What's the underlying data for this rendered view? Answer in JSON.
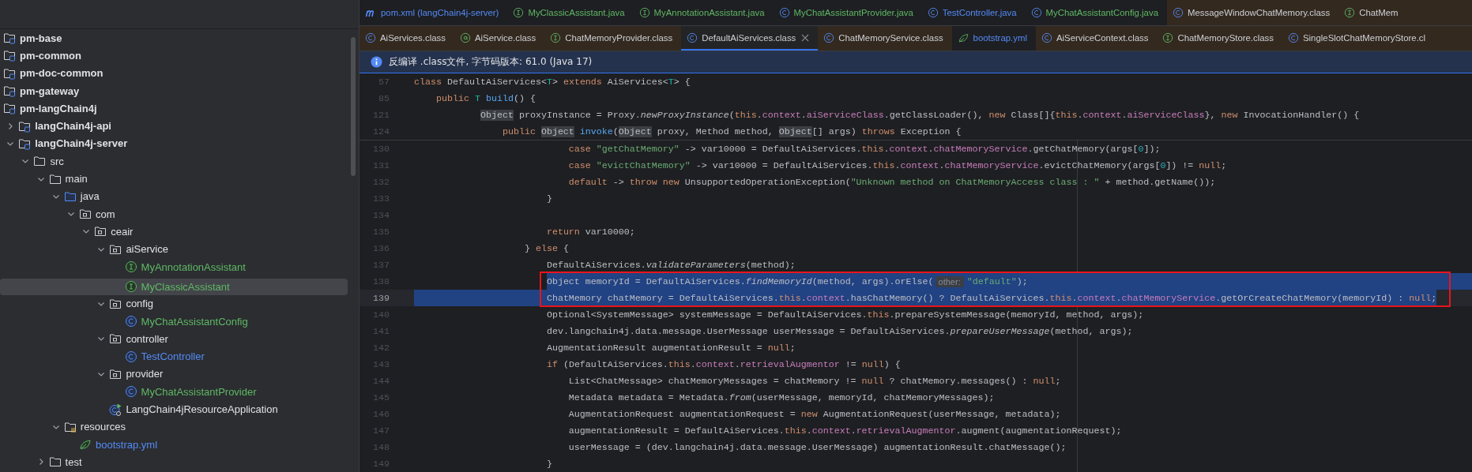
{
  "sidebar": {
    "items": [
      {
        "label": "pm-base",
        "kind": "module",
        "selected": false
      },
      {
        "label": "pm-common",
        "kind": "module",
        "selected": false
      },
      {
        "label": "pm-doc-common",
        "kind": "module",
        "selected": false
      },
      {
        "label": "pm-gateway",
        "kind": "module",
        "selected": false
      },
      {
        "label": "pm-langChain4j",
        "kind": "module",
        "selected": false,
        "children": [
          {
            "label": "langChain4j-api",
            "kind": "module",
            "expanded": false,
            "selected": false
          },
          {
            "label": "langChain4j-server",
            "kind": "module",
            "expanded": true,
            "selected": false,
            "children": [
              {
                "label": "src",
                "kind": "folder",
                "expanded": true,
                "selected": false,
                "children": [
                  {
                    "label": "main",
                    "kind": "folder",
                    "expanded": true,
                    "selected": false,
                    "children": [
                      {
                        "label": "java",
                        "kind": "source_root",
                        "expanded": true,
                        "selected": false,
                        "children": [
                          {
                            "label": "com",
                            "kind": "package",
                            "expanded": true,
                            "selected": false,
                            "children": [
                              {
                                "label": "ceair",
                                "kind": "package",
                                "expanded": true,
                                "selected": false,
                                "children": [
                                  {
                                    "label": "aiService",
                                    "kind": "package",
                                    "expanded": true,
                                    "selected": false,
                                    "children": [
                                      {
                                        "label": "MyAnnotationAssistant",
                                        "kind": "interface",
                                        "color": "#5fb865",
                                        "selected": false
                                      },
                                      {
                                        "label": "MyClassicAssistant",
                                        "kind": "interface",
                                        "color": "#5fb865",
                                        "selected": true
                                      }
                                    ]
                                  },
                                  {
                                    "label": "config",
                                    "kind": "package",
                                    "expanded": true,
                                    "selected": false,
                                    "children": [
                                      {
                                        "label": "MyChatAssistantConfig",
                                        "kind": "class",
                                        "color": "#5fb865",
                                        "selected": false
                                      }
                                    ]
                                  },
                                  {
                                    "label": "controller",
                                    "kind": "package",
                                    "expanded": true,
                                    "selected": false,
                                    "children": [
                                      {
                                        "label": "TestController",
                                        "kind": "class",
                                        "color": "#548af7",
                                        "selected": false
                                      }
                                    ]
                                  },
                                  {
                                    "label": "provider",
                                    "kind": "package",
                                    "expanded": true,
                                    "selected": false,
                                    "children": [
                                      {
                                        "label": "MyChatAssistantProvider",
                                        "kind": "class",
                                        "color": "#5fb865",
                                        "selected": false
                                      }
                                    ]
                                  },
                                  {
                                    "label": "LangChain4jResourceApplication",
                                    "kind": "app",
                                    "selected": false
                                  }
                                ]
                              }
                            ]
                          }
                        ]
                      },
                      {
                        "label": "resources",
                        "kind": "resources",
                        "expanded": true,
                        "selected": false,
                        "children": [
                          {
                            "label": "bootstrap.yml",
                            "kind": "yaml",
                            "color": "#548af7",
                            "selected": false
                          }
                        ]
                      }
                    ]
                  },
                  {
                    "label": "test",
                    "kind": "folder",
                    "expanded": false,
                    "selected": false
                  }
                ]
              }
            ]
          }
        ]
      }
    ]
  },
  "tabs_row_1": [
    {
      "label": "pom.xml (langChain4j-server)",
      "kind": "maven",
      "color": "#548af7",
      "library": false,
      "selected": false
    },
    {
      "label": "MyClassicAssistant.java",
      "kind": "interface",
      "color": "#5fb865",
      "library": false,
      "selected": false
    },
    {
      "label": "MyAnnotationAssistant.java",
      "kind": "interface",
      "color": "#5fb865",
      "library": false,
      "selected": false
    },
    {
      "label": "MyChatAssistantProvider.java",
      "kind": "class",
      "color": "#5fb865",
      "library": false,
      "selected": false
    },
    {
      "label": "TestController.java",
      "kind": "class",
      "color": "#548af7",
      "library": false,
      "selected": false
    },
    {
      "label": "MyChatAssistantConfig.java",
      "kind": "class",
      "color": "#5fb865",
      "library": false,
      "selected": false
    },
    {
      "label": "MessageWindowChatMemory.class",
      "kind": "class",
      "library": true,
      "selected": false
    },
    {
      "label": "ChatMem",
      "kind": "interface",
      "library": true,
      "selected": false
    }
  ],
  "tabs_row_2": [
    {
      "label": "AiServices.class",
      "kind": "class",
      "library": true,
      "selected": false
    },
    {
      "label": "AiService.class",
      "kind": "annotation",
      "library": true,
      "selected": false
    },
    {
      "label": "ChatMemoryProvider.class",
      "kind": "interface",
      "library": true,
      "selected": false
    },
    {
      "label": "DefaultAiServices.class",
      "kind": "class",
      "library": true,
      "selected": true
    },
    {
      "label": "ChatMemoryService.class",
      "kind": "class",
      "library": true,
      "selected": false
    },
    {
      "label": "bootstrap.yml",
      "kind": "yaml",
      "color": "#548af7",
      "library": false,
      "selected": false
    },
    {
      "label": "AiServiceContext.class",
      "kind": "class",
      "library": true,
      "selected": false
    },
    {
      "label": "ChatMemoryStore.class",
      "kind": "interface",
      "library": true,
      "selected": false
    },
    {
      "label": "SingleSlotChatMemoryStore.cl",
      "kind": "class",
      "library": true,
      "selected": false
    }
  ],
  "info_bar": {
    "text": "反编译 .class文件, 字节码版本: 61.0 (Java 17)"
  },
  "editor": {
    "sticky_lines": [
      {
        "number": "57",
        "tokens": [
          {
            "kind": "keyword",
            "text": "class"
          },
          {
            "text": " DefaultAiServices<"
          },
          {
            "kind": "type_parameter",
            "text": "T"
          },
          {
            "text": "> "
          },
          {
            "kind": "keyword",
            "text": "extends"
          },
          {
            "text": " AiServices<"
          },
          {
            "kind": "type_parameter",
            "text": "T"
          },
          {
            "text": "> {"
          }
        ]
      },
      {
        "number": "85",
        "tokens": [
          {
            "kind": "keyword",
            "text": "    public"
          },
          {
            "text": " T",
            "kind": "type_parameter"
          },
          {
            "kind": "declaration",
            "text": " build"
          },
          {
            "text": "() {"
          }
        ]
      },
      {
        "number": "121",
        "tokens": [
          {
            "kind": "usage",
            "text": "            Object"
          },
          {
            "text": " proxyInstance = Proxy."
          },
          {
            "kind": "static_call",
            "text": "newProxyInstance"
          },
          {
            "text": "("
          },
          {
            "kind": "keyword",
            "text": "this"
          },
          {
            "text": "."
          },
          {
            "kind": "field",
            "text": "context"
          },
          {
            "text": "."
          },
          {
            "kind": "field",
            "text": "aiServiceClass"
          },
          {
            "text": ".getClassLoader(), "
          },
          {
            "kind": "keyword",
            "text": "new"
          },
          {
            "text": " Class[]{"
          },
          {
            "kind": "keyword",
            "text": "this"
          },
          {
            "text": "."
          },
          {
            "kind": "field",
            "text": "context"
          },
          {
            "text": "."
          },
          {
            "kind": "field",
            "text": "aiServiceClass"
          },
          {
            "text": "}, "
          },
          {
            "kind": "keyword",
            "text": "new"
          },
          {
            "text": " InvocationHandler() {"
          }
        ]
      },
      {
        "number": "124",
        "tokens": [
          {
            "kind": "keyword",
            "text": "                public "
          },
          {
            "kind": "usage",
            "text": "Object"
          },
          {
            "kind": "declaration",
            "text": " invoke"
          },
          {
            "text": "("
          },
          {
            "kind": "usage",
            "text": "Object"
          },
          {
            "text": " proxy, Method method, "
          },
          {
            "kind": "usage",
            "text": "Object"
          },
          {
            "text": "[] args) "
          },
          {
            "kind": "keyword",
            "text": "throws"
          },
          {
            "text": " Exception {"
          }
        ]
      }
    ],
    "lines": [
      {
        "number": "130",
        "tokens": [
          {
            "kind": "keyword",
            "text": "                            case"
          },
          {
            "kind": "string",
            "text": " \"getChatMemory\""
          },
          {
            "text": " -> var10000 = DefaultAiServices."
          },
          {
            "kind": "keyword",
            "text": "this"
          },
          {
            "text": "."
          },
          {
            "kind": "field",
            "text": "context"
          },
          {
            "text": "."
          },
          {
            "kind": "field",
            "text": "chatMemoryService"
          },
          {
            "text": ".getChatMemory(args["
          },
          {
            "kind": "number",
            "text": "0"
          },
          {
            "text": "]);"
          }
        ]
      },
      {
        "number": "131",
        "tokens": [
          {
            "kind": "keyword",
            "text": "                            case"
          },
          {
            "kind": "string",
            "text": " \"evictChatMemory\""
          },
          {
            "text": " -> var10000 = DefaultAiServices."
          },
          {
            "kind": "keyword",
            "text": "this"
          },
          {
            "text": "."
          },
          {
            "kind": "field",
            "text": "context"
          },
          {
            "text": "."
          },
          {
            "kind": "field",
            "text": "chatMemoryService"
          },
          {
            "text": ".evictChatMemory(args["
          },
          {
            "kind": "number",
            "text": "0"
          },
          {
            "text": "]) != "
          },
          {
            "kind": "keyword",
            "text": "null"
          },
          {
            "text": ";"
          }
        ]
      },
      {
        "number": "132",
        "tokens": [
          {
            "kind": "keyword",
            "text": "                            default"
          },
          {
            "text": " -> "
          },
          {
            "kind": "keyword",
            "text": "throw new"
          },
          {
            "text": " UnsupportedOperationException("
          },
          {
            "kind": "string",
            "text": "\"Unknown method on ChatMemoryAccess class : \""
          },
          {
            "text": " + method.getName());"
          }
        ]
      },
      {
        "number": "133",
        "tokens": [
          {
            "text": "                        }"
          }
        ]
      },
      {
        "number": "134"
      },
      {
        "number": "135",
        "tokens": [
          {
            "kind": "keyword",
            "text": "                        return"
          },
          {
            "text": " var10000;"
          }
        ]
      },
      {
        "number": "136",
        "tokens": [
          {
            "text": "                    } "
          },
          {
            "kind": "keyword",
            "text": "else"
          },
          {
            "text": " {"
          }
        ]
      },
      {
        "number": "137",
        "tokens": [
          {
            "text": "                        DefaultAiServices."
          },
          {
            "kind": "static_call",
            "text": "validateParameters"
          },
          {
            "text": "(method);"
          }
        ]
      },
      {
        "number": "138",
        "selected": true,
        "current": false,
        "boxed": true,
        "tokens": [
          {
            "text": "                        Object memoryId = DefaultAiServices."
          },
          {
            "kind": "static_call",
            "text": "findMemoryId"
          },
          {
            "text": "(method, args).orElse("
          },
          {
            "kind": "hint",
            "text": "other:"
          },
          {
            "kind": "string",
            "text": "\"default\""
          },
          {
            "text": ");"
          }
        ]
      },
      {
        "number": "139",
        "selected": true,
        "current": true,
        "boxed": true,
        "tokens": [
          {
            "text": "                        ChatMemory chatMemory = DefaultAiServices."
          },
          {
            "kind": "keyword",
            "text": "this"
          },
          {
            "text": "."
          },
          {
            "kind": "field",
            "text": "context"
          },
          {
            "text": ".hasChatMemory() ? DefaultAiServices."
          },
          {
            "kind": "keyword",
            "text": "this"
          },
          {
            "text": "."
          },
          {
            "kind": "field",
            "text": "context"
          },
          {
            "text": "."
          },
          {
            "kind": "field",
            "text": "chatMemoryService"
          },
          {
            "text": ".getOrCreateChatMemory(memoryId) : "
          },
          {
            "kind": "keyword",
            "text": "null"
          },
          {
            "text": ";"
          }
        ]
      },
      {
        "number": "140",
        "tokens": [
          {
            "text": "                        Optional<SystemMessage> systemMessage = DefaultAiServices."
          },
          {
            "kind": "keyword",
            "text": "this"
          },
          {
            "text": ".prepareSystemMessage(memoryId, method, args);"
          }
        ]
      },
      {
        "number": "141",
        "tokens": [
          {
            "text": "                        dev.langchain4j.data.message.UserMessage userMessage = DefaultAiServices."
          },
          {
            "kind": "static_call",
            "text": "prepareUserMessage"
          },
          {
            "text": "(method, args);"
          }
        ]
      },
      {
        "number": "142",
        "tokens": [
          {
            "text": "                        AugmentationResult augmentationResult = "
          },
          {
            "kind": "keyword",
            "text": "null"
          },
          {
            "text": ";"
          }
        ]
      },
      {
        "number": "143",
        "tokens": [
          {
            "kind": "keyword",
            "text": "                        if"
          },
          {
            "text": " (DefaultAiServices."
          },
          {
            "kind": "keyword",
            "text": "this"
          },
          {
            "text": "."
          },
          {
            "kind": "field",
            "text": "context"
          },
          {
            "text": "."
          },
          {
            "kind": "field",
            "text": "retrievalAugmentor"
          },
          {
            "text": " != "
          },
          {
            "kind": "keyword",
            "text": "null"
          },
          {
            "text": ") {"
          }
        ]
      },
      {
        "number": "144",
        "tokens": [
          {
            "text": "                            List<ChatMessage> chatMemoryMessages = chatMemory != "
          },
          {
            "kind": "keyword",
            "text": "null"
          },
          {
            "text": " ? chatMemory.messages() : "
          },
          {
            "kind": "keyword",
            "text": "null"
          },
          {
            "text": ";"
          }
        ]
      },
      {
        "number": "145",
        "tokens": [
          {
            "text": "                            Metadata metadata = Metadata."
          },
          {
            "kind": "static_call",
            "text": "from"
          },
          {
            "text": "(userMessage, memoryId, chatMemoryMessages);"
          }
        ]
      },
      {
        "number": "146",
        "tokens": [
          {
            "text": "                            AugmentationRequest augmentationRequest = "
          },
          {
            "kind": "keyword",
            "text": "new"
          },
          {
            "text": " AugmentationRequest(userMessage, metadata);"
          }
        ]
      },
      {
        "number": "147",
        "tokens": [
          {
            "text": "                            augmentationResult = DefaultAiServices."
          },
          {
            "kind": "keyword",
            "text": "this"
          },
          {
            "text": "."
          },
          {
            "kind": "field",
            "text": "context"
          },
          {
            "text": "."
          },
          {
            "kind": "field",
            "text": "retrievalAugmentor"
          },
          {
            "text": ".augment(augmentationRequest);"
          }
        ]
      },
      {
        "number": "148",
        "tokens": [
          {
            "text": "                            userMessage = (dev.langchain4j.data.message.UserMessage) augmentationResult.chatMessage();"
          }
        ]
      },
      {
        "number": "149",
        "tokens": [
          {
            "text": "                        }"
          }
        ]
      }
    ]
  }
}
